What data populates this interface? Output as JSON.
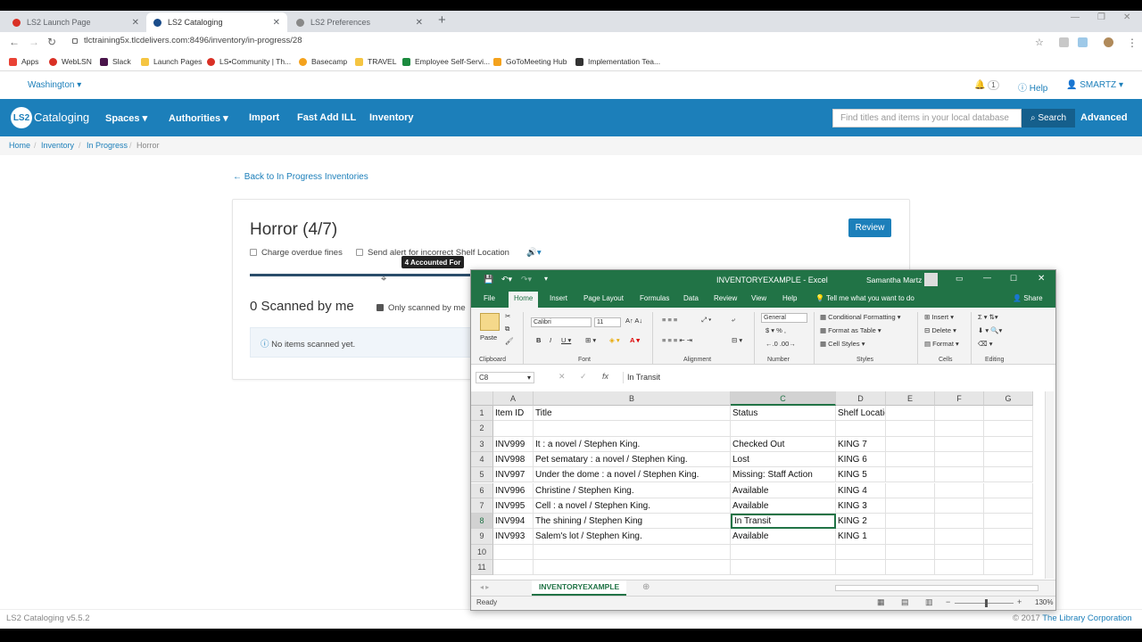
{
  "browser": {
    "tabs": [
      {
        "title": "LS2 Launch Page",
        "color": "#d93025"
      },
      {
        "title": "LS2 Cataloging",
        "color": "#1a4c8a"
      },
      {
        "title": "LS2 Preferences",
        "color": "#888888"
      }
    ],
    "url": "tlctraining5x.tlcdelivers.com:8496/inventory/in-progress/28",
    "bookmarks": [
      "Apps",
      "WebLSN",
      "Slack",
      "Launch Pages",
      "LS•Community | Th...",
      "Basecamp",
      "TRAVEL",
      "Employee Self-Servi...",
      "GoToMeeting Hub",
      "Implementation Tea..."
    ]
  },
  "app": {
    "library": "Washington",
    "notifications": "1",
    "help": "Help",
    "user": "SMARTZ",
    "logo_badge": "LS2",
    "logo_text": "Cataloging",
    "nav": [
      "Spaces",
      "Authorities",
      "Import",
      "Fast Add ILL",
      "Inventory"
    ],
    "search_placeholder": "Find titles and items in your local database",
    "search_button": "Search",
    "advanced": "Advanced",
    "breadcrumb": [
      "Home",
      "Inventory",
      "In Progress",
      "Horror"
    ]
  },
  "page": {
    "back_link": "← Back to In Progress Inventories",
    "title": "Horror (4/7)",
    "review_button": "Review",
    "charge_overdue": "Charge overdue fines",
    "send_alert": "Send alert for incorrect Shelf Location",
    "tooltip": "4 Accounted For",
    "progress": 0.57,
    "scanned_title": "0 Scanned by me",
    "only_scanned": "Only scanned by me",
    "empty_message": "No items scanned yet."
  },
  "footer": {
    "version": "LS2 Cataloging v5.5.2",
    "copyright": "© 2017",
    "company": "The Library Corporation"
  },
  "excel": {
    "title": "INVENTORYEXAMPLE  -  Excel",
    "user": "Samantha Martz",
    "share": "Share",
    "tabs": [
      "File",
      "Home",
      "Insert",
      "Page Layout",
      "Formulas",
      "Data",
      "Review",
      "View",
      "Help",
      "Tell me what you want to do"
    ],
    "ribbon": {
      "paste": "Paste",
      "clipboard": "Clipboard",
      "font_name": "Calibri",
      "font_size": "11",
      "font": "Font",
      "alignment": "Alignment",
      "number_format": "General",
      "number": "Number",
      "conditional": "Conditional Formatting",
      "format_table": "Format as Table",
      "cell_styles": "Cell Styles",
      "styles": "Styles",
      "insert": "Insert",
      "delete": "Delete",
      "format": "Format",
      "cells": "Cells",
      "editing": "Editing"
    },
    "name_box": "C8",
    "formula": "In Transit",
    "columns": [
      "A",
      "B",
      "C",
      "D",
      "E",
      "F",
      "G"
    ],
    "rows": [
      [
        "Item ID",
        "Title",
        "Status",
        "Shelf Location"
      ],
      [
        "",
        "",
        "",
        ""
      ],
      [
        "INV999",
        "It : a novel / Stephen King.",
        "Checked Out",
        "KING 7"
      ],
      [
        "INV998",
        "Pet sematary : a novel / Stephen King.",
        "Lost",
        "KING 6"
      ],
      [
        "INV997",
        "Under the dome : a novel / Stephen King.",
        "Missing: Staff Action",
        "KING 5"
      ],
      [
        "INV996",
        "Christine / Stephen King.",
        "Available",
        "KING 4"
      ],
      [
        "INV995",
        "Cell : a novel / Stephen King.",
        "Available",
        "KING 3"
      ],
      [
        "INV994",
        "The shining / Stephen King",
        "In Transit",
        "KING 2"
      ],
      [
        "INV993",
        "Salem's lot / Stephen King.",
        "Available",
        "KING 1"
      ],
      [
        "",
        "",
        "",
        ""
      ],
      [
        "",
        "",
        "",
        ""
      ]
    ],
    "row_numbers": [
      "1",
      "2",
      "3",
      "4",
      "5",
      "6",
      "7",
      "8",
      "9",
      "10",
      "11"
    ],
    "sheet": "INVENTORYEXAMPLE",
    "status": "Ready",
    "zoom": "130%"
  }
}
